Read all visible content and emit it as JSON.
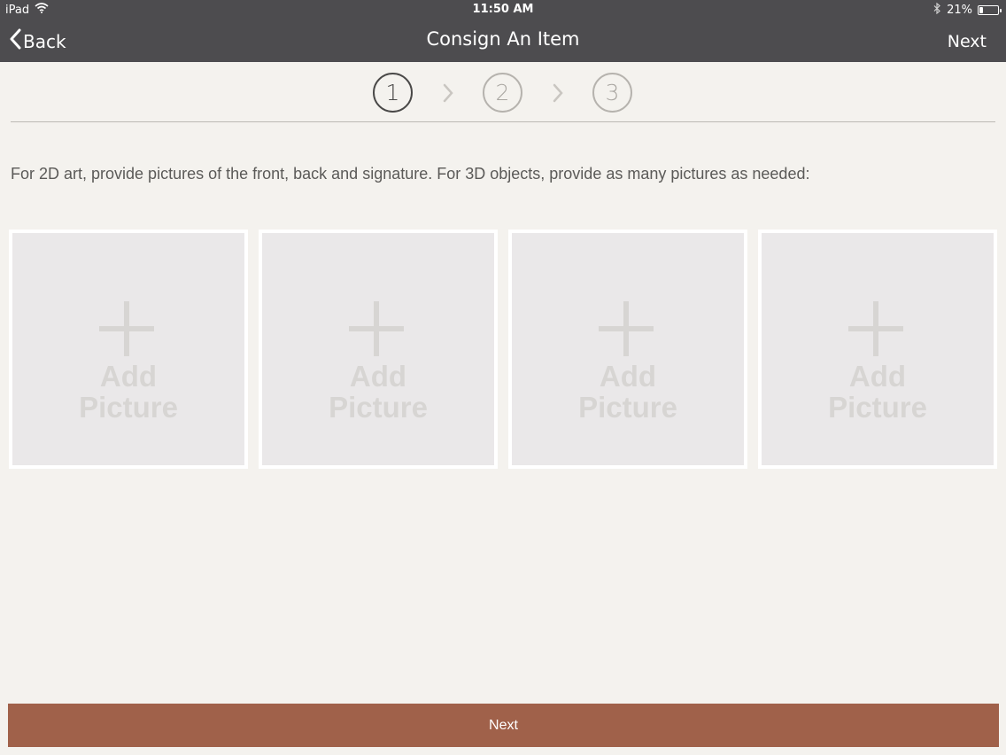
{
  "status_bar": {
    "device": "iPad",
    "time": "11:50 AM",
    "battery_percent": "21%",
    "battery_level": 0.21,
    "icons": [
      "wifi-icon",
      "bluetooth-icon",
      "battery-icon"
    ]
  },
  "nav": {
    "back_label": "Back",
    "title": "Consign An Item",
    "next_label": "Next"
  },
  "steps": [
    {
      "label": "1",
      "active": true
    },
    {
      "label": "2",
      "active": false
    },
    {
      "label": "3",
      "active": false
    }
  ],
  "instructions": "For 2D art, provide pictures of the front, back and signature.  For 3D objects, provide as many pictures as needed:",
  "tiles": [
    {
      "line1": "Add",
      "line2": "Picture"
    },
    {
      "line1": "Add",
      "line2": "Picture"
    },
    {
      "line1": "Add",
      "line2": "Picture"
    },
    {
      "line1": "Add",
      "line2": "Picture"
    }
  ],
  "footer": {
    "next_button_label": "Next"
  },
  "colors": {
    "navbar": "#4d4c4f",
    "background": "#f4f2ee",
    "primary_button": "#a0614a",
    "tile": "#eae8e9"
  }
}
